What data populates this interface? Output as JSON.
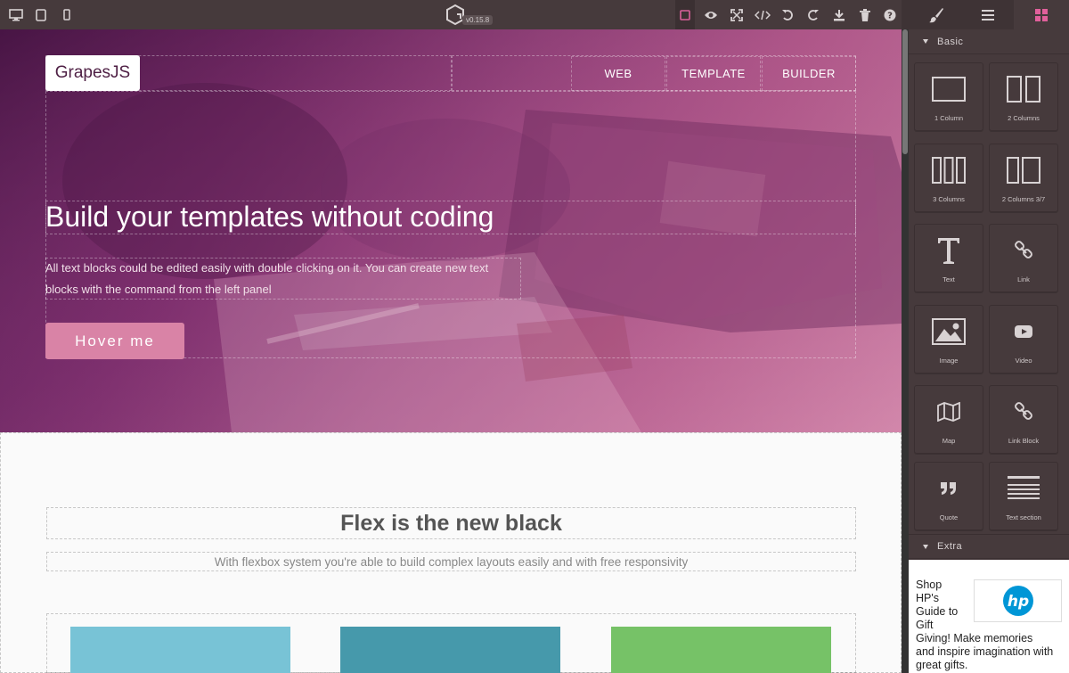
{
  "topbar": {
    "devices": [
      "desktop-icon",
      "tablet-icon",
      "mobile-icon"
    ],
    "logo": "grapesjs-logo",
    "version": "v0.15.8",
    "actions": [
      "sw-visibility-icon",
      "preview-icon",
      "fullscreen-icon",
      "export-code-icon",
      "undo-icon",
      "redo-icon",
      "download-icon",
      "trash-icon",
      "help-icon"
    ]
  },
  "right_tabs": [
    "style-manager-icon",
    "layer-manager-icon",
    "blocks-icon"
  ],
  "hero": {
    "brand": "GrapesJS",
    "menu": [
      "WEB",
      "TEMPLATE",
      "BUILDER"
    ],
    "title": "Build your templates without coding",
    "description": "All text blocks could be edited easily with double clicking on it. You can create new text blocks with the command from the left panel",
    "button": "Hover me"
  },
  "flex_section": {
    "title": "Flex is the new black",
    "subtitle": "With flexbox system you're able to build complex layouts easily and with free responsivity"
  },
  "cards": [
    {
      "color": "#78c3d6"
    },
    {
      "color": "#4699ab"
    },
    {
      "color": "#76c267"
    }
  ],
  "blocks_panel": {
    "basic_label": "Basic",
    "extra_label": "Extra",
    "blocks": [
      {
        "label": "1 Column",
        "icon": "one-column-icon"
      },
      {
        "label": "2 Columns",
        "icon": "two-columns-icon"
      },
      {
        "label": "3 Columns",
        "icon": "three-columns-icon"
      },
      {
        "label": "2 Columns 3/7",
        "icon": "two-columns-37-icon"
      },
      {
        "label": "Text",
        "icon": "text-icon"
      },
      {
        "label": "Link",
        "icon": "link-icon"
      },
      {
        "label": "Image",
        "icon": "image-icon"
      },
      {
        "label": "Video",
        "icon": "video-icon"
      },
      {
        "label": "Map",
        "icon": "map-icon"
      },
      {
        "label": "Link Block",
        "icon": "link-block-icon"
      },
      {
        "label": "Quote",
        "icon": "quote-icon"
      },
      {
        "label": "Text section",
        "icon": "text-section-icon"
      }
    ],
    "extra": {
      "text_lines": [
        "Shop",
        "HP's",
        "Guide to",
        "Gift",
        "Giving! Make memories",
        "and inspire imagination with",
        "great gifts."
      ],
      "logo_text": "hp"
    }
  },
  "colors": {
    "topbar_bg": "#463a3c",
    "accent": "#d983a6",
    "hero_start": "#5b1f58",
    "hero_end": "#c97aa0"
  }
}
